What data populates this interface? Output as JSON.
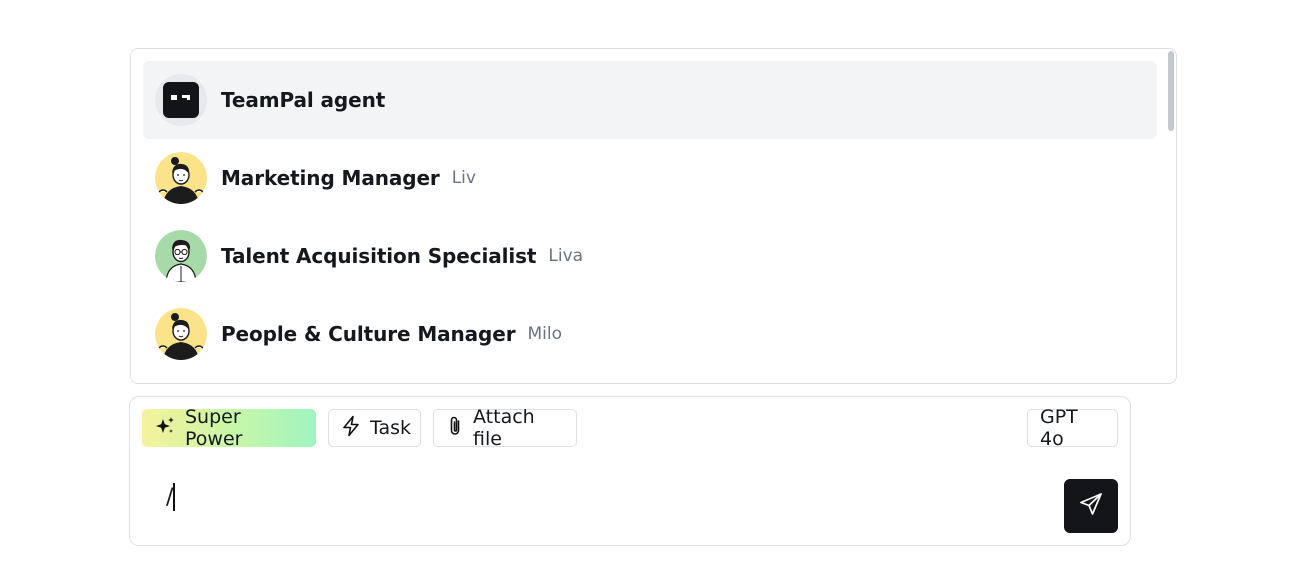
{
  "agents": [
    {
      "name": "TeamPal agent",
      "sub": "",
      "avatar": "teampal-logo-icon",
      "selected": true
    },
    {
      "name": "Marketing Manager",
      "sub": "Liv",
      "avatar": "woman-bun-avatar-icon",
      "selected": false
    },
    {
      "name": "Talent Acquisition Specialist",
      "sub": "Liva",
      "avatar": "man-glasses-avatar-icon",
      "selected": false
    },
    {
      "name": "People & Culture Manager",
      "sub": "Milo",
      "avatar": "woman-bun-avatar-icon",
      "selected": false
    }
  ],
  "toolbar": {
    "super_power_label": "Super Power",
    "task_label": "Task",
    "attach_label": "Attach file",
    "model_label": "GPT 4o"
  },
  "input": {
    "value": "/"
  },
  "colors": {
    "selected_row_bg": "#f3f4f6",
    "send_button_bg": "#141518",
    "super_gradient_start": "#f6f29c",
    "super_gradient_end": "#9ff5c1",
    "avatar_yellow": "#fbe38a",
    "avatar_green": "#a8d9a8"
  }
}
